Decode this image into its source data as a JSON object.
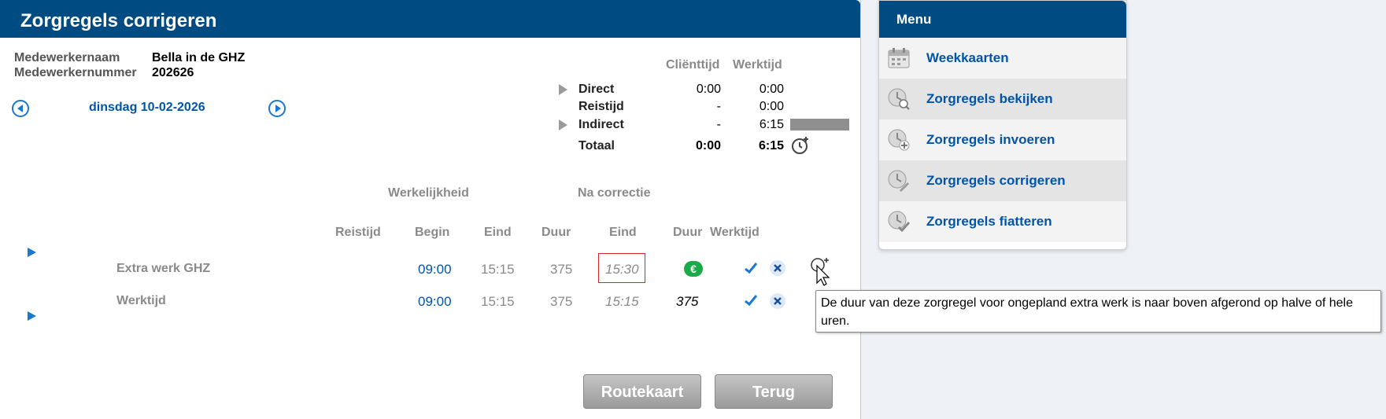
{
  "main": {
    "title": "Zorgregels corrigeren",
    "employee_name_label": "Medewerkernaam",
    "employee_name": "Bella in de GHZ",
    "employee_number_label": "Medewerkernummer",
    "employee_number": "202626",
    "date": "dinsdag 10-02-2026"
  },
  "summary": {
    "col_client": "Cliënttijd",
    "col_work": "Werktijd",
    "rows": [
      {
        "label": "Direct",
        "client": "0:00",
        "work": "0:00"
      },
      {
        "label": "Reistijd",
        "client": "-",
        "work": "0:00"
      },
      {
        "label": "Indirect",
        "client": "-",
        "work": "6:15"
      }
    ],
    "total_label": "Totaal",
    "total_client": "0:00",
    "total_work": "6:15"
  },
  "table": {
    "group_reality": "Werkelijkheid",
    "group_correction": "Na correctie",
    "headers": {
      "travel": "Reistijd",
      "begin": "Begin",
      "end": "Eind",
      "duration": "Duur",
      "corr_end": "Eind",
      "corr_duration": "Duur",
      "worktime": "Werktijd"
    },
    "rows": [
      {
        "name": "Extra werk GHZ",
        "begin": "09:00",
        "end": "15:15",
        "duration": "375",
        "corr_end": "15:30",
        "corr_duration": "€"
      },
      {
        "name": "Werktijd",
        "begin": "09:00",
        "end": "15:15",
        "duration": "375",
        "corr_end": "15:15",
        "corr_duration": "375"
      }
    ]
  },
  "buttons": {
    "routekaart": "Routekaart",
    "terug": "Terug"
  },
  "menu": {
    "title": "Menu",
    "items": [
      {
        "label": "Weekkaarten",
        "icon": "calendar-icon"
      },
      {
        "label": "Zorgregels bekijken",
        "icon": "search-clock-icon"
      },
      {
        "label": "Zorgregels invoeren",
        "icon": "add-clock-icon"
      },
      {
        "label": "Zorgregels corrigeren",
        "icon": "edit-clock-icon"
      },
      {
        "label": "Zorgregels fiatteren",
        "icon": "approve-clock-icon"
      }
    ]
  },
  "tooltip": {
    "text": "De duur van deze zorgregel voor ongepland extra werk is naar boven afgerond op halve of hele uren."
  },
  "colors": {
    "header_bg": "#004c82",
    "link": "#0055aa",
    "euro_badge": "#1aaa4a"
  }
}
